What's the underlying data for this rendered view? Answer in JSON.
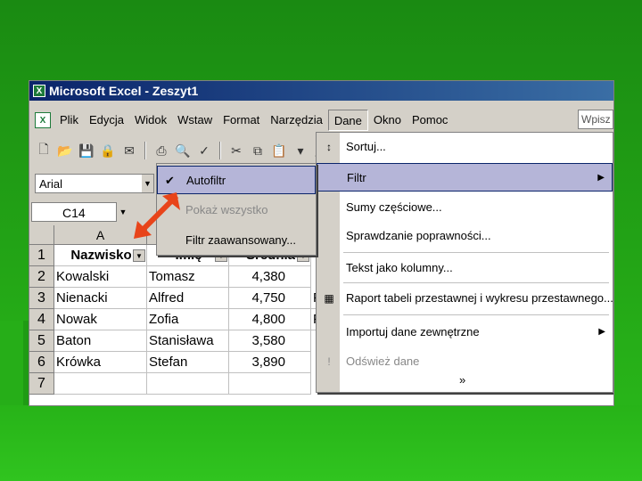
{
  "window": {
    "title": "Microsoft Excel - Zeszyt1",
    "app_icon": "excel-icon"
  },
  "menubar": {
    "items": [
      "Plik",
      "Edycja",
      "Widok",
      "Wstaw",
      "Format",
      "Narzędzia",
      "Dane",
      "Okno",
      "Pomoc"
    ],
    "active": "Dane",
    "help_placeholder": "Wpisz p"
  },
  "formatting": {
    "font": "Arial"
  },
  "namebox": {
    "value": "C14"
  },
  "sheet": {
    "columns": [
      "A",
      "B",
      "C"
    ],
    "row_numbers": [
      "1",
      "2",
      "3",
      "4",
      "5",
      "6",
      "7"
    ],
    "headers": [
      "Nazwisko",
      "Imię",
      "Średnia"
    ],
    "rows": [
      [
        "Kowalski",
        "Tomasz",
        "4,380"
      ],
      [
        "Nienacki",
        "Alfred",
        "4,750"
      ],
      [
        "Nowak",
        "Zofia",
        "4,800"
      ],
      [
        "Baton",
        "Stanisława",
        "3,580"
      ],
      [
        "Krówka",
        "Stefan",
        "3,890"
      ]
    ],
    "partial_d": [
      "F",
      "F"
    ]
  },
  "filter_submenu": {
    "items": [
      {
        "label": "Autofiltr",
        "checked": true,
        "selected": true
      },
      {
        "label": "Pokaż wszystko",
        "disabled": true
      },
      {
        "label": "Filtr zaawansowany..."
      }
    ]
  },
  "dane_menu": {
    "items": [
      {
        "label": "Sortuj...",
        "icon": "sort-az-icon"
      },
      {
        "label": "Filtr",
        "submenu": true,
        "selected": true
      },
      {
        "label": "Sumy częściowe..."
      },
      {
        "label": "Sprawdzanie poprawności..."
      },
      {
        "label": "Tekst jako kolumny..."
      },
      {
        "label": "Raport tabeli przestawnej i wykresu przestawnego...",
        "icon": "pivot-table-icon"
      },
      {
        "label": "Importuj dane zewnętrzne",
        "submenu": true
      },
      {
        "label": "Odśwież dane",
        "disabled": true,
        "icon": "refresh-exclamation-icon"
      }
    ],
    "expand_glyph": "»"
  },
  "colors": {
    "background_green": "#23a516",
    "titlebar_blue": "#0a246a",
    "highlight": "#b5b5d8",
    "arrow_red": "#e8441a"
  }
}
